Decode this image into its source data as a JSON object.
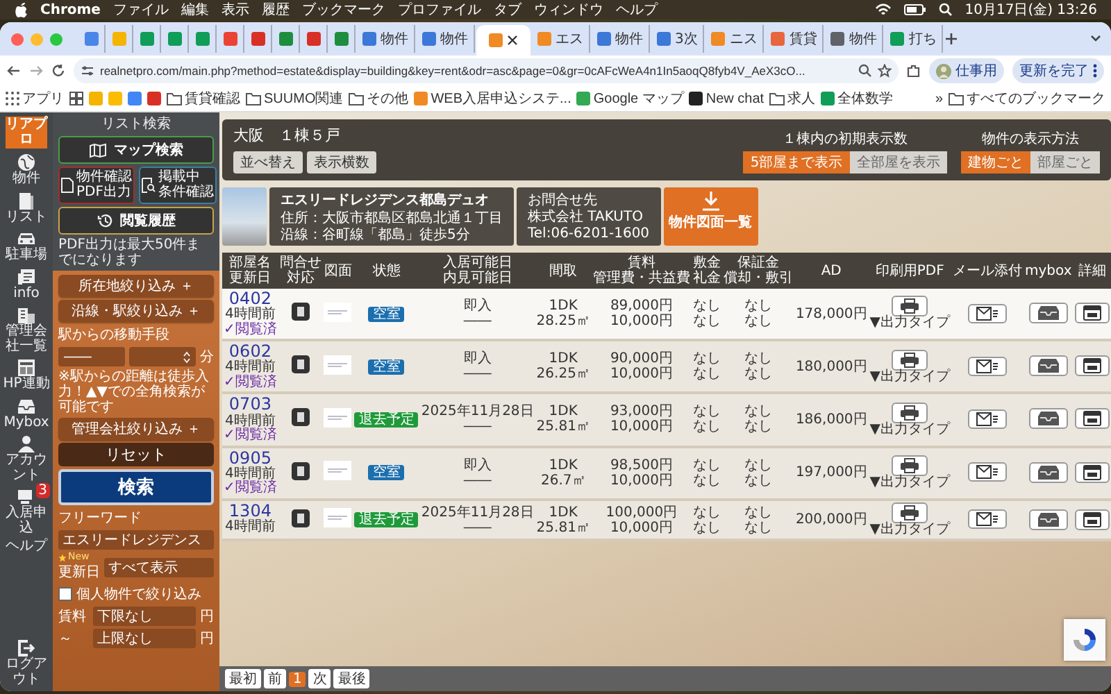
{
  "menubar": {
    "app": "Chrome",
    "menus": [
      "ファイル",
      "編集",
      "表示",
      "履歴",
      "ブックマーク",
      "プロファイル",
      "タブ",
      "ウィンドウ",
      "ヘルプ"
    ],
    "clock": "10月17日(金) 13:26"
  },
  "browser": {
    "tabs": [
      {
        "color": "#4a86e8",
        "selected": false
      },
      {
        "color": "#f4b400",
        "selected": false
      },
      {
        "color": "#0f9d58",
        "selected": false
      },
      {
        "color": "#0f9d58",
        "selected": false
      },
      {
        "color": "#0f9d58",
        "selected": false
      },
      {
        "color": "#ea4335",
        "selected": false
      },
      {
        "color": "#d93025",
        "selected": false
      },
      {
        "color": "#1e8e3e",
        "selected": false
      },
      {
        "color": "#d93025",
        "selected": false
      },
      {
        "color": "#1e8e3e",
        "selected": false
      },
      {
        "color": "#3c78d8",
        "label": "物件",
        "selected": false
      },
      {
        "color": "#3c78d8",
        "label": "物件",
        "selected": false
      },
      {
        "color": "#f08a24",
        "selected": true
      },
      {
        "color": "#f08a24",
        "label": "エス",
        "selected": false
      },
      {
        "color": "#3c78d8",
        "label": "物件",
        "selected": false
      },
      {
        "color": "#3c78d8",
        "label": "3次",
        "selected": false
      },
      {
        "color": "#f08a24",
        "label": "ニス",
        "selected": false
      },
      {
        "color": "#e8663d",
        "label": "賃貸",
        "selected": false
      },
      {
        "color": "#5f6368",
        "label": "物件",
        "selected": false
      },
      {
        "color": "#0f9d58",
        "label": "打ち",
        "selected": false
      }
    ],
    "url": "realnetpro.com/main.php?method=estate&display=building&key=rent&odr=asc&page=0&gr=0cAFcWeA4n1In5aoqQ8fyb4V_AeX3cO...",
    "profile": "仕事用",
    "update": "更新を完了",
    "bookmarks": [
      {
        "kind": "apps",
        "label": "アプリ"
      },
      {
        "kind": "grid"
      },
      {
        "kind": "site",
        "color": "#f4b400"
      },
      {
        "kind": "site",
        "color": "#fbbc04"
      },
      {
        "kind": "site",
        "color": "#4285f4"
      },
      {
        "kind": "site",
        "color": "#d93025"
      },
      {
        "kind": "folder",
        "label": "賃貸確認"
      },
      {
        "kind": "folder",
        "label": "SUUMO関連"
      },
      {
        "kind": "folder",
        "label": "その他"
      },
      {
        "kind": "site",
        "color": "#f08a24",
        "label": "WEB入居申込システ..."
      },
      {
        "kind": "site",
        "color": "#34a853",
        "label": "Google マップ"
      },
      {
        "kind": "site",
        "color": "#222222",
        "label": "New chat"
      },
      {
        "kind": "folder",
        "label": "求人"
      },
      {
        "kind": "site",
        "color": "#0f9d58",
        "label": "全体数学"
      }
    ],
    "more": "»",
    "all_bookmarks": "すべてのブックマーク"
  },
  "rail": {
    "logo": "リアプロ",
    "items": [
      {
        "kind": "building",
        "label": "物件"
      },
      {
        "kind": "list",
        "label": "リスト"
      },
      {
        "kind": "car",
        "label": "駐車場"
      },
      {
        "kind": "info",
        "label": "info"
      },
      {
        "kind": "company",
        "label": "管理会社一覧"
      },
      {
        "kind": "hp",
        "label": "HP連動"
      },
      {
        "kind": "mybox",
        "label": "Mybox"
      },
      {
        "kind": "account",
        "label": "アカウント"
      },
      {
        "kind": "apply",
        "label": "入居申込",
        "badge": "3"
      },
      {
        "kind": "help",
        "label": "ヘルプ"
      },
      {
        "kind": "logout",
        "label": "ログアウト"
      }
    ]
  },
  "sidebar": {
    "title": "リスト検索",
    "map_button": "マップ検索",
    "pdf_button": [
      "物件確認",
      "PDF出力"
    ],
    "conditions_button": [
      "掲載中",
      "条件確認"
    ],
    "history_button": "閲覧履歴",
    "note": "PDF出力は最大50件までになります",
    "area_filter": "所在地絞り込み ＋",
    "line_filter": "沿線・駅絞り込み ＋",
    "transport": {
      "label": "駅からの移動手段",
      "means": "――",
      "unit": "分",
      "note": "※駅からの距離は徒歩入力！▲▼での全角検索が可能です"
    },
    "company_filter": "管理会社絞り込み ＋",
    "reset": "リセット",
    "search": "検索",
    "freeword": {
      "label": "フリーワード",
      "value": "エスリードレジデンス"
    },
    "updated": {
      "badge": "New",
      "label": "更新日",
      "value": "すべて表示"
    },
    "personal": {
      "label": "個人物件で絞り込み",
      "checked": false
    },
    "rent": {
      "label": "賃料",
      "min": "下限なし",
      "min_unit": "円",
      "tilde": "～",
      "max": "上限なし",
      "max_unit": "円"
    }
  },
  "header": {
    "area": "大阪",
    "count": "１棟５戸",
    "buttons": [
      "並べ替え",
      "表示横数"
    ],
    "initial_display": {
      "label": "１棟内の初期表示数",
      "options": [
        {
          "label": "5部屋まで表示",
          "selected": true
        },
        {
          "label": "全部屋を表示",
          "selected": false
        }
      ]
    },
    "display_method": {
      "label": "物件の表示方法",
      "options": [
        {
          "label": "建物ごと",
          "selected": true
        },
        {
          "label": "部屋ごと",
          "selected": false
        }
      ]
    }
  },
  "building": {
    "name": "エスリードレジデンス都島デュオ",
    "address": "住所：大阪市都島区都島北通１丁目",
    "line": "沿線：谷町線「都島」徒歩5分",
    "contact_label": "お問合せ先",
    "company": "株式会社 TAKUTO",
    "tel": "Tel:06-6201-1600",
    "download": "物件図面一覧"
  },
  "table": {
    "columns": [
      [
        "部屋名",
        "更新日"
      ],
      [
        "問合せ",
        "対応"
      ],
      [
        "図面"
      ],
      [
        "状態"
      ],
      [
        "入居可能日",
        "内見可能日"
      ],
      [
        "間取"
      ],
      [
        "賃料",
        "管理費・共益費"
      ],
      [
        "敷金",
        "礼金"
      ],
      [
        "保証金",
        "償却・敷引"
      ],
      [
        "AD"
      ],
      [
        "印刷用PDF"
      ],
      [
        "メール添付"
      ],
      [
        "mybox"
      ],
      [
        "詳細"
      ]
    ],
    "rows": [
      {
        "room": "0402",
        "updated": "4時間前",
        "viewed": "✓閲覧済",
        "selected": true,
        "status": {
          "label": "空室",
          "color": "#1b6fae"
        },
        "move_in": [
          "即入",
          "――"
        ],
        "layout": [
          "1DK",
          "28.25㎡"
        ],
        "rent": [
          "89,000円",
          "10,000円"
        ],
        "deposit": [
          "なし",
          "なし"
        ],
        "guarantee": [
          "なし",
          "なし"
        ],
        "ad": "178,000円",
        "output": "▼出力タイプ"
      },
      {
        "room": "0602",
        "updated": "4時間前",
        "viewed": "✓閲覧済",
        "selected": false,
        "status": {
          "label": "空室",
          "color": "#1b6fae"
        },
        "move_in": [
          "即入",
          "――"
        ],
        "layout": [
          "1DK",
          "26.25㎡"
        ],
        "rent": [
          "90,000円",
          "10,000円"
        ],
        "deposit": [
          "なし",
          "なし"
        ],
        "guarantee": [
          "なし",
          "なし"
        ],
        "ad": "180,000円",
        "output": "▼出力タイプ"
      },
      {
        "room": "0703",
        "updated": "4時間前",
        "viewed": "✓閲覧済",
        "selected": false,
        "status": {
          "label": "退去予定",
          "color": "#1f9a3a"
        },
        "move_in": [
          "2025年11月28日",
          "――"
        ],
        "layout": [
          "1DK",
          "25.81㎡"
        ],
        "rent": [
          "93,000円",
          "10,000円"
        ],
        "deposit": [
          "なし",
          "なし"
        ],
        "guarantee": [
          "なし",
          "なし"
        ],
        "ad": "186,000円",
        "output": "▼出力タイプ"
      },
      {
        "room": "0905",
        "updated": "4時間前",
        "viewed": "✓閲覧済",
        "selected": false,
        "status": {
          "label": "空室",
          "color": "#1b6fae"
        },
        "move_in": [
          "即入",
          "――"
        ],
        "layout": [
          "1DK",
          "26.7㎡"
        ],
        "rent": [
          "98,500円",
          "10,000円"
        ],
        "deposit": [
          "なし",
          "なし"
        ],
        "guarantee": [
          "なし",
          "なし"
        ],
        "ad": "197,000円",
        "output": "▼出力タイプ"
      },
      {
        "room": "1304",
        "updated": "4時間前",
        "selected": false,
        "status": {
          "label": "退去予定",
          "color": "#1f9a3a"
        },
        "move_in": [
          "2025年11月28日",
          "――"
        ],
        "layout": [
          "1DK",
          "25.81㎡"
        ],
        "rent": [
          "100,000円",
          "10,000円"
        ],
        "deposit": [
          "なし",
          "なし"
        ],
        "guarantee": [
          "なし",
          "なし"
        ],
        "ad": "200,000円",
        "output": "▼出力タイプ"
      }
    ]
  },
  "pagination": [
    {
      "label": "最初",
      "selected": false
    },
    {
      "label": "前",
      "selected": false
    },
    {
      "label": "1",
      "selected": true
    },
    {
      "label": "次",
      "selected": false
    },
    {
      "label": "最後",
      "selected": false
    }
  ]
}
